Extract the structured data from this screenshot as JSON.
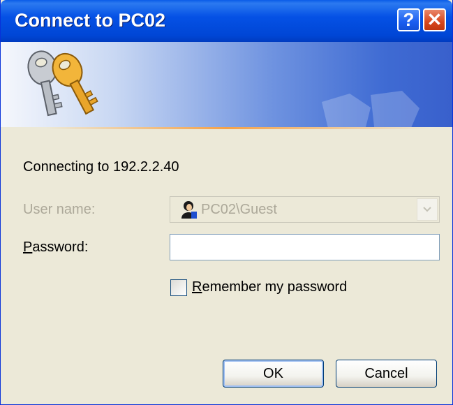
{
  "window": {
    "title": "Connect to PC02",
    "help_glyph": "?",
    "close_glyph": "✕"
  },
  "banner": {
    "icon": "keys-icon",
    "watermark": "keys-watermark"
  },
  "content": {
    "connecting_text": "Connecting to 192.2.2.40",
    "username_label": "User name:",
    "username_value": "PC02\\Guest",
    "username_enabled": false,
    "password_label_rest": "assword:",
    "password_label_accel": "P",
    "password_value": "",
    "remember_label_accel": "R",
    "remember_label_rest": "emember my password",
    "remember_checked": false
  },
  "buttons": {
    "ok": "OK",
    "cancel": "Cancel"
  },
  "colors": {
    "title_bar": "#0551e5",
    "dialog_bg": "#ece9d8",
    "close_button": "#d8471d",
    "disabled_text": "#aca899"
  }
}
